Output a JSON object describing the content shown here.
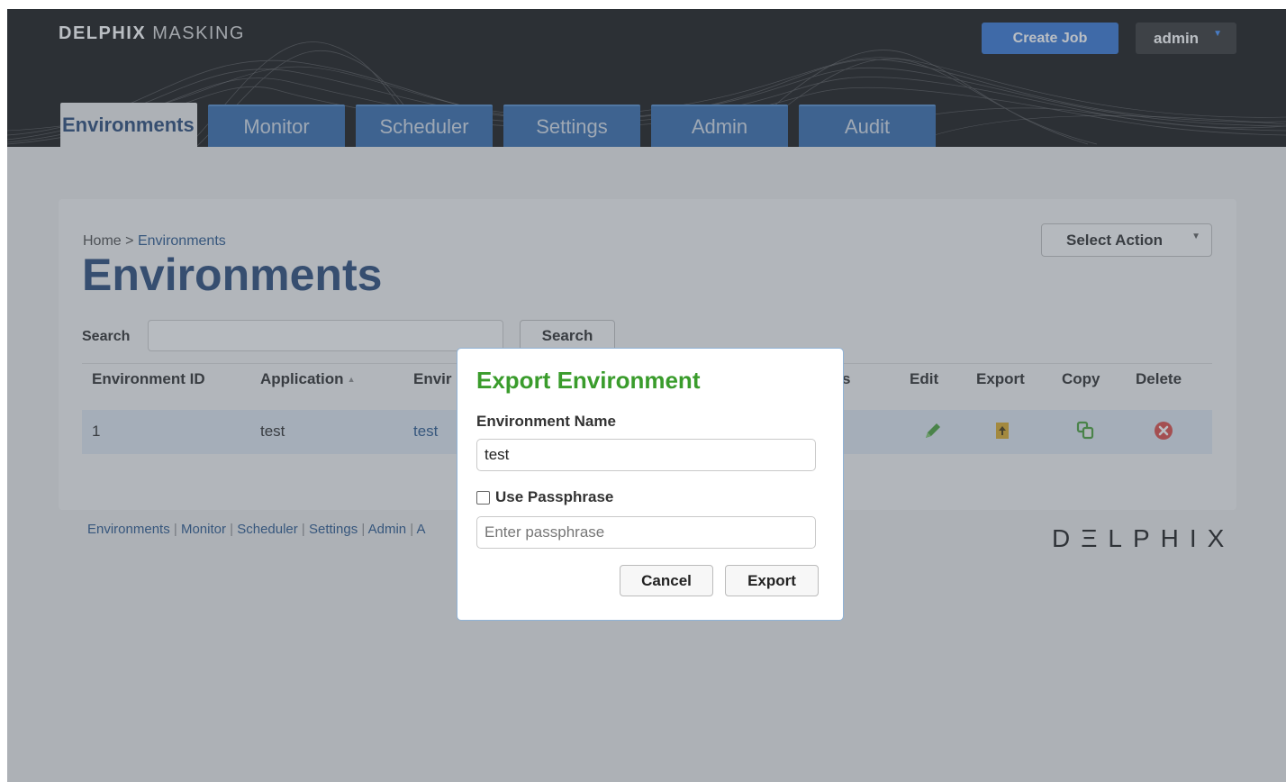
{
  "header": {
    "logo_bold": "DELPHIX",
    "logo_light": "MASKING",
    "create_job": "Create Job",
    "user": "admin"
  },
  "tabs": [
    {
      "label": "Environments",
      "active": true
    },
    {
      "label": "Monitor"
    },
    {
      "label": "Scheduler"
    },
    {
      "label": "Settings"
    },
    {
      "label": "Admin"
    },
    {
      "label": "Audit"
    }
  ],
  "breadcrumb": {
    "home": "Home",
    "separator": ">",
    "current": "Environments"
  },
  "page_title": "Environments",
  "select_action": "Select Action",
  "search": {
    "label": "Search",
    "button": "Search",
    "value": ""
  },
  "table": {
    "headers": {
      "environment_id": "Environment ID",
      "application": "Application",
      "environment": "Envir",
      "s": "s",
      "edit": "Edit",
      "export": "Export",
      "copy": "Copy",
      "delete": "Delete"
    },
    "rows": [
      {
        "environment_id": "1",
        "application": "test",
        "environment": "test"
      }
    ]
  },
  "footer": {
    "links": [
      "Environments",
      "Monitor",
      "Scheduler",
      "Settings",
      "Admin",
      "A"
    ],
    "brand": "DΞLPHIX"
  },
  "modal": {
    "title": "Export Environment",
    "name_label": "Environment Name",
    "name_value": "test",
    "passphrase_label": "Use Passphrase",
    "passphrase_checked": false,
    "passphrase_placeholder": "Enter passphrase",
    "cancel": "Cancel",
    "export": "Export"
  },
  "colors": {
    "accent_blue": "#2b6fd0",
    "tab_blue": "#2a63a8",
    "title_blue": "#1d3f70",
    "modal_title_green": "#3a9c2c",
    "delete_red": "#d9413b",
    "edit_green": "#3e9a2f",
    "export_gold": "#d8a41c",
    "copy_green": "#3e9a2f"
  }
}
